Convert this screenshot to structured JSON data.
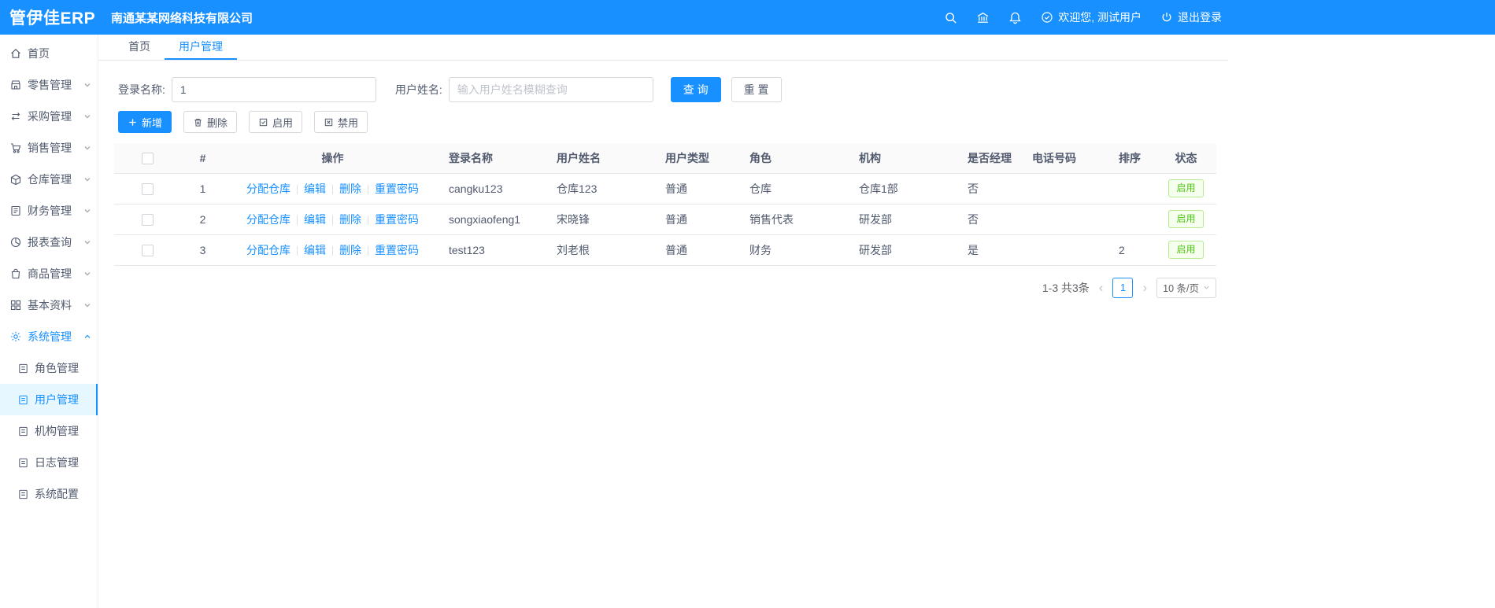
{
  "colors": {
    "primary": "#1890ff",
    "success": "#52c41a",
    "active_bg": "#e6f7ff"
  },
  "topbar": {
    "logo": "管伊佳ERP",
    "company": "南通某某网络科技有限公司",
    "welcome": "欢迎您, 测试用户",
    "logout": "退出登录"
  },
  "sidebar": {
    "items": [
      {
        "label": "首页"
      },
      {
        "label": "零售管理"
      },
      {
        "label": "采购管理"
      },
      {
        "label": "销售管理"
      },
      {
        "label": "仓库管理"
      },
      {
        "label": "财务管理"
      },
      {
        "label": "报表查询"
      },
      {
        "label": "商品管理"
      },
      {
        "label": "基本资料"
      },
      {
        "label": "系统管理"
      }
    ],
    "system_children": [
      {
        "label": "角色管理"
      },
      {
        "label": "用户管理"
      },
      {
        "label": "机构管理"
      },
      {
        "label": "日志管理"
      },
      {
        "label": "系统配置"
      }
    ]
  },
  "tabs": [
    {
      "label": "首页"
    },
    {
      "label": "用户管理"
    }
  ],
  "search": {
    "login_label": "登录名称:",
    "login_value": "1",
    "name_label": "用户姓名:",
    "name_placeholder": "输入用户姓名模糊查询",
    "query_label": "查 询",
    "reset_label": "重 置"
  },
  "toolbar": {
    "add_label": "新增",
    "delete_label": "删除",
    "enable_label": "启用",
    "disable_label": "禁用"
  },
  "table": {
    "headers": [
      "#",
      "操作",
      "登录名称",
      "用户姓名",
      "用户类型",
      "角色",
      "机构",
      "是否经理",
      "电话号码",
      "排序",
      "状态"
    ],
    "op_links": [
      "分配仓库",
      "编辑",
      "删除",
      "重置密码"
    ],
    "rows": [
      {
        "index": "1",
        "login": "cangku123",
        "name": "仓库123",
        "type": "普通",
        "role": "仓库",
        "org": "仓库1部",
        "manager": "否",
        "phone": "",
        "sort": "",
        "status": "启用"
      },
      {
        "index": "2",
        "login": "songxiaofeng1",
        "name": "宋晓锋",
        "type": "普通",
        "role": "销售代表",
        "org": "研发部",
        "manager": "否",
        "phone": "",
        "sort": "",
        "status": "启用"
      },
      {
        "index": "3",
        "login": "test123",
        "name": "刘老根",
        "type": "普通",
        "role": "财务",
        "org": "研发部",
        "manager": "是",
        "phone": "",
        "sort": "2",
        "status": "启用"
      }
    ]
  },
  "pagination": {
    "total_text": "1-3 共3条",
    "current_page": "1",
    "page_size_label": "10 条/页"
  }
}
